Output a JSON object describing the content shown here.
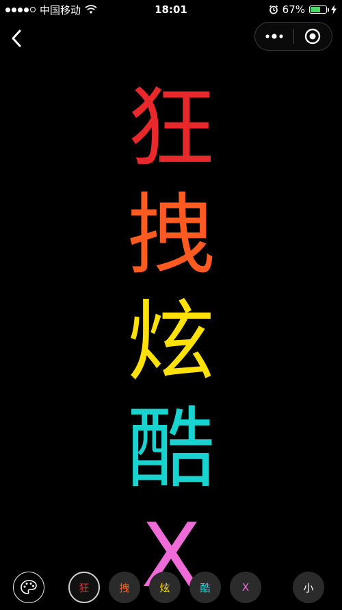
{
  "status_bar": {
    "carrier": "中国移动",
    "time": "18:01",
    "battery_percent": "67%",
    "battery_level": 0.67,
    "signal_bars": 4,
    "signal_total": 5
  },
  "nav": {
    "back_icon": "chevron-left-icon",
    "more_icon": "more-dots-icon",
    "close_icon": "target-circle-icon"
  },
  "display": {
    "characters": [
      {
        "char": "狂",
        "color": "#e8282b"
      },
      {
        "char": "拽",
        "color": "#ff5a1f"
      },
      {
        "char": "炫",
        "color": "#ffe10a"
      },
      {
        "char": "酷",
        "color": "#18d3cf"
      },
      {
        "char": "X",
        "color": "#ee6bd8"
      }
    ]
  },
  "toolbar": {
    "palette_icon": "palette-icon",
    "chips": [
      {
        "label": "狂",
        "color": "#e8282b",
        "selected": true
      },
      {
        "label": "拽",
        "color": "#ff5a1f",
        "selected": false
      },
      {
        "label": "炫",
        "color": "#ffe10a",
        "selected": false
      },
      {
        "label": "酷",
        "color": "#18d3cf",
        "selected": false
      },
      {
        "label": "X",
        "color": "#ee6bd8",
        "selected": false
      }
    ],
    "size_label": "小"
  }
}
